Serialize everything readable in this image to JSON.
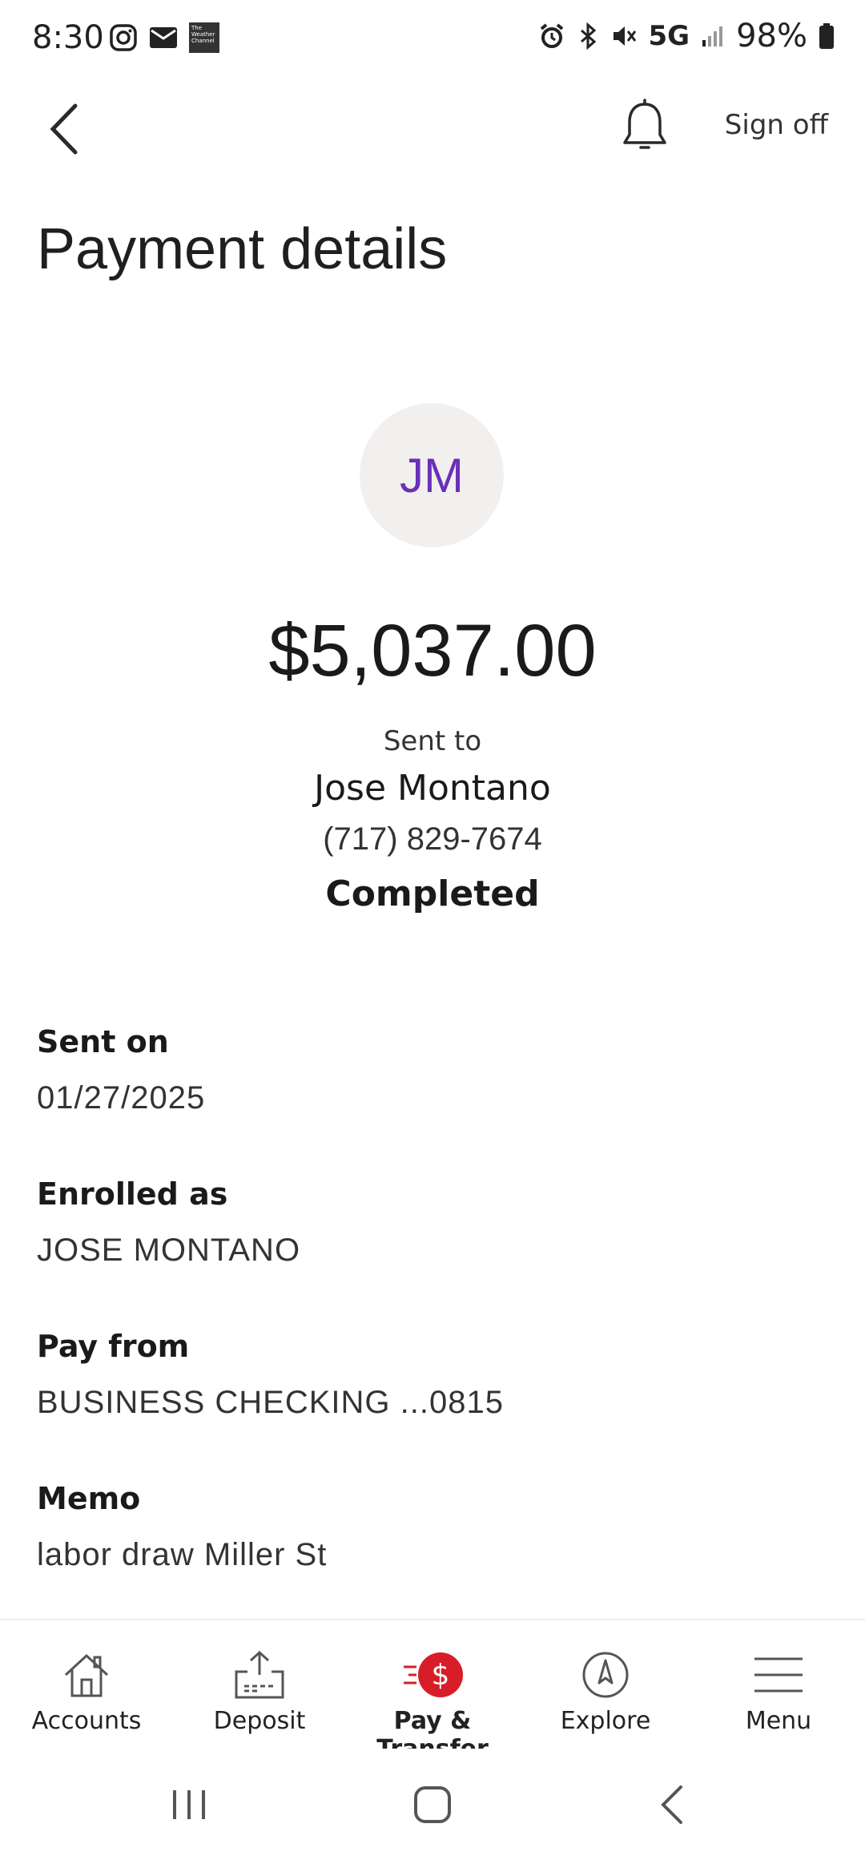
{
  "status_bar": {
    "time": "8:30",
    "network": "5G",
    "battery": "98%",
    "left_icons": [
      "instagram-icon",
      "mail-icon",
      "weather-channel-icon"
    ],
    "right_icons": [
      "alarm-icon",
      "bluetooth-icon",
      "mute-icon",
      "signal-icon",
      "battery-icon"
    ],
    "weather_badge": "The Weather Channel"
  },
  "header": {
    "back_icon": "chevron-left-icon",
    "notification_icon": "bell-icon",
    "sign_off_label": "Sign off"
  },
  "page": {
    "title": "Payment details"
  },
  "payment": {
    "avatar_initials": "JM",
    "amount": "$5,037.00",
    "sent_to_label": "Sent to",
    "recipient_name": "Jose Montano",
    "recipient_phone": "(717) 829-7674",
    "status": "Completed"
  },
  "details": [
    {
      "label": "Sent on",
      "value": "01/27/2025"
    },
    {
      "label": "Enrolled as",
      "value": "JOSE MONTANO"
    },
    {
      "label": "Pay from",
      "value": "BUSINESS CHECKING ...0815"
    },
    {
      "label": "Memo",
      "value": "labor draw Miller St"
    }
  ],
  "bottom_nav": [
    {
      "label": "Accounts",
      "icon": "home-icon",
      "active": false
    },
    {
      "label": "Deposit",
      "icon": "deposit-icon",
      "active": false
    },
    {
      "label": "Pay & Transfer",
      "icon": "pay-transfer-icon",
      "active": true
    },
    {
      "label": "Explore",
      "icon": "compass-icon",
      "active": false
    },
    {
      "label": "Menu",
      "icon": "hamburger-menu-icon",
      "active": false
    }
  ],
  "colors": {
    "accent_red": "#d71e28",
    "avatar_text": "#6b2fb8",
    "avatar_bg": "#f2f0ef"
  }
}
